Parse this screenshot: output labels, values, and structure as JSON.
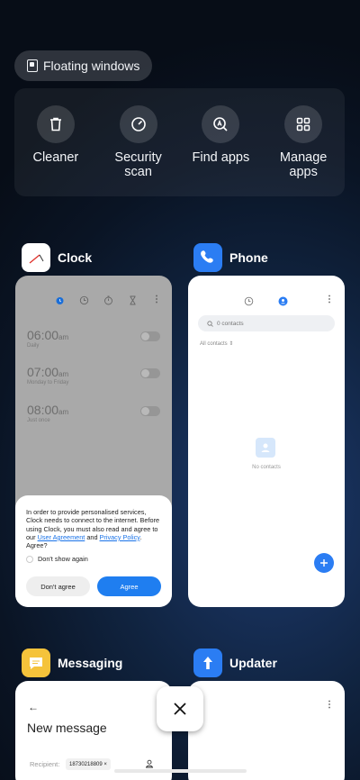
{
  "floating_windows_label": "Floating windows",
  "tools": [
    {
      "label": "Cleaner",
      "icon": "trash-icon"
    },
    {
      "label": "Security\nscan",
      "icon": "security-scan-icon"
    },
    {
      "label": "Find apps",
      "icon": "find-apps-icon"
    },
    {
      "label": "Manage\napps",
      "icon": "grid-icon"
    }
  ],
  "apps": {
    "clock": {
      "name": "Clock",
      "alarms": [
        {
          "time": "06:00",
          "suffix": "am",
          "repeat": "Daily"
        },
        {
          "time": "07:00",
          "suffix": "am",
          "repeat": "Monday to Friday"
        },
        {
          "time": "08:00",
          "suffix": "am",
          "repeat": "Just once"
        }
      ],
      "dialog": {
        "text_before": "In order to provide personalised services, Clock needs to connect to the internet. Before using Clock, you must also read and agree to our ",
        "link1": "User Agreement",
        "text_mid": " and ",
        "link2": "Privacy Policy",
        "text_after": ". Agree?",
        "checkbox_label": "Don't show again",
        "decline": "Don't agree",
        "accept": "Agree"
      }
    },
    "phone": {
      "name": "Phone",
      "search_placeholder": "0 contacts",
      "filter": "All contacts",
      "empty": "No contacts"
    },
    "messaging": {
      "name": "Messaging",
      "title": "New message",
      "recipient_label": "Recipient:",
      "recipient_value": "18730218809"
    },
    "updater": {
      "name": "Updater"
    }
  },
  "colors": {
    "accent_blue": "#1f7ef0",
    "messaging_yellow": "#f5c33b",
    "phone_blue": "#2b7df3"
  }
}
